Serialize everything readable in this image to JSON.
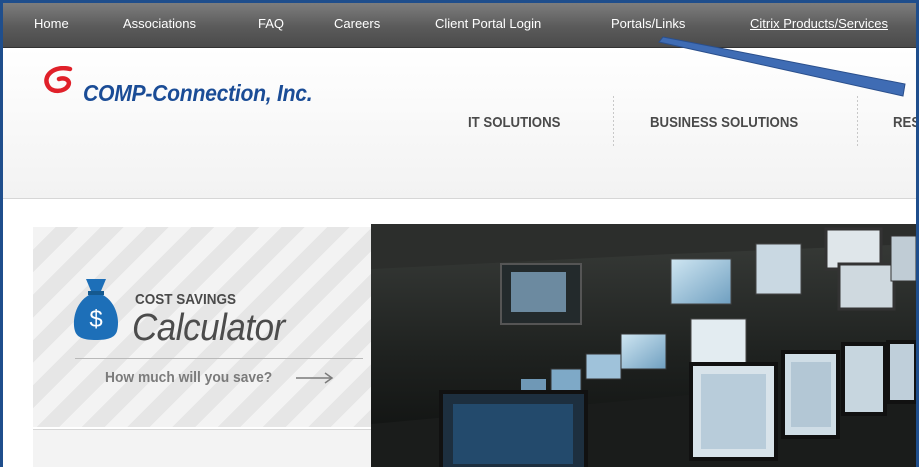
{
  "topnav": {
    "items": [
      {
        "label": "Home"
      },
      {
        "label": "Associations"
      },
      {
        "label": "FAQ"
      },
      {
        "label": "Careers"
      },
      {
        "label": "Client Portal Login"
      },
      {
        "label": "Portals/Links"
      },
      {
        "label": "Citrix Products/Services"
      }
    ]
  },
  "header": {
    "logo_text": "COMP-Connection, Inc.",
    "mainnav": [
      {
        "label": "IT SOLUTIONS"
      },
      {
        "label": "BUSINESS SOLUTIONS"
      },
      {
        "label": "RES"
      }
    ]
  },
  "calculator": {
    "icon_symbol": "$",
    "title": "COST SAVINGS",
    "subtitle": "Calculator",
    "prompt": "How much will you save?"
  },
  "colors": {
    "nav_bg": "#5a5a5a",
    "logo_blue": "#1a4c96",
    "logo_red": "#e0212a",
    "bag_blue": "#1d6fb8",
    "frame_border": "#1f4e8c",
    "annotation_arrow": "#3f6cb4"
  },
  "icons": {
    "logo": "swoosh-logo-icon",
    "calculator": "money-bag-icon",
    "arrow": "arrow-right-icon"
  }
}
